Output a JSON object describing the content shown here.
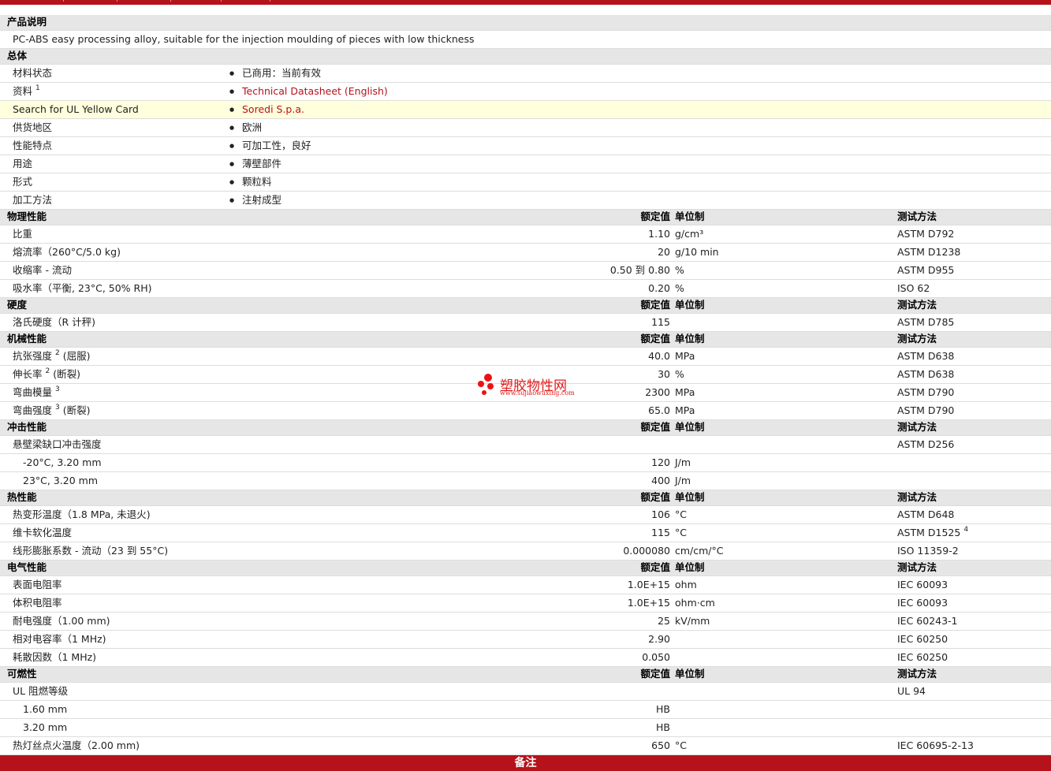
{
  "colors": {
    "brand_red": "#b5121b",
    "header_gray": "#e6e6e6",
    "highlight": "#ffffdd"
  },
  "desc": {
    "section": "产品说明",
    "text": "PC-ABS easy processing alloy, suitable for the injection moulding of pieces with low thickness"
  },
  "general": {
    "section": "总体",
    "rows": [
      {
        "label": "材料状态",
        "value": "已商用：当前有效"
      },
      {
        "label": "资料",
        "sup": "1",
        "value": "Technical Datasheet (English)"
      },
      {
        "label": "Search for UL Yellow Card",
        "value": "Soredi S.p.a."
      },
      {
        "label": "供货地区",
        "value": "欧洲"
      },
      {
        "label": "性能特点",
        "value": "可加工性，良好"
      },
      {
        "label": "用途",
        "value": "薄壁部件"
      },
      {
        "label": "形式",
        "value": "颗粒料"
      },
      {
        "label": "加工方法",
        "value": "注射成型"
      }
    ]
  },
  "col_headers": {
    "value": "额定值",
    "unit": "单位制",
    "test": "测试方法"
  },
  "physical": {
    "section": "物理性能",
    "rows": [
      {
        "label": "比重",
        "value": "1.10",
        "unit": "g/cm³",
        "test": "ASTM D792"
      },
      {
        "label": "熔流率（260°C/5.0 kg)",
        "value": "20",
        "unit": "g/10 min",
        "test": "ASTM D1238"
      },
      {
        "label": "收缩率 - 流动",
        "value": "0.50 到 0.80",
        "unit": "%",
        "test": "ASTM D955"
      },
      {
        "label": "吸水率（平衡, 23°C, 50% RH)",
        "value": "0.20",
        "unit": "%",
        "test": "ISO 62"
      }
    ]
  },
  "hardness": {
    "section": "硬度",
    "rows": [
      {
        "label": "洛氏硬度（R 计秤)",
        "value": "115",
        "unit": "",
        "test": "ASTM D785"
      }
    ]
  },
  "mechanical": {
    "section": "机械性能",
    "rows": [
      {
        "label": "抗张强度",
        "sup": "2",
        "suffix": "(屈服)",
        "value": "40.0",
        "unit": "MPa",
        "test": "ASTM D638"
      },
      {
        "label": "伸长率",
        "sup": "2",
        "suffix": "(断裂)",
        "value": "30",
        "unit": "%",
        "test": "ASTM D638"
      },
      {
        "label": "弯曲模量",
        "sup": "3",
        "suffix": "",
        "value": "2300",
        "unit": "MPa",
        "test": "ASTM D790"
      },
      {
        "label": "弯曲强度",
        "sup": "3",
        "suffix": "(断裂)",
        "value": "65.0",
        "unit": "MPa",
        "test": "ASTM D790"
      }
    ]
  },
  "impact": {
    "section": "冲击性能",
    "title_row": {
      "label": "悬壁梁缺口冲击强度",
      "test": "ASTM D256"
    },
    "rows": [
      {
        "label": "-20°C, 3.20 mm",
        "value": "120",
        "unit": "J/m"
      },
      {
        "label": "23°C, 3.20 mm",
        "value": "400",
        "unit": "J/m"
      }
    ]
  },
  "thermal": {
    "section": "热性能",
    "rows": [
      {
        "label": "热变形温度（1.8 MPa, 未退火)",
        "value": "106",
        "unit": "°C",
        "test": "ASTM D648"
      },
      {
        "label": "维卡软化温度",
        "value": "115",
        "unit": "°C",
        "test": "ASTM D1525",
        "test_sup": "4"
      },
      {
        "label": "线形膨胀系数 - 流动（23 到 55°C)",
        "value": "0.000080",
        "unit": "cm/cm/°C",
        "test": "ISO 11359-2"
      }
    ]
  },
  "electrical": {
    "section": "电气性能",
    "rows": [
      {
        "label": "表面电阻率",
        "value": "1.0E+15",
        "unit": "ohm",
        "test": "IEC 60093"
      },
      {
        "label": "体积电阻率",
        "value": "1.0E+15",
        "unit": "ohm·cm",
        "test": "IEC 60093"
      },
      {
        "label": "耐电强度（1.00 mm)",
        "value": "25",
        "unit": "kV/mm",
        "test": "IEC 60243-1"
      },
      {
        "label": "相对电容率（1 MHz)",
        "value": "2.90",
        "unit": "",
        "test": "IEC 60250"
      },
      {
        "label": "耗散因数（1 MHz)",
        "value": "0.050",
        "unit": "",
        "test": "IEC 60250"
      }
    ]
  },
  "flammability": {
    "section": "可燃性",
    "title_row": {
      "label": "UL 阻燃等级",
      "test": "UL 94"
    },
    "rows": [
      {
        "label": "1.60 mm",
        "value": "HB"
      },
      {
        "label": "3.20 mm",
        "value": "HB"
      }
    ],
    "last_row": {
      "label": "热灯丝点火温度（2.00 mm)",
      "value": "650",
      "unit": "°C",
      "test": "IEC 60695-2-13"
    }
  },
  "watermark": {
    "name": "塑胶物性网",
    "url": "www.sujiaowuxing.com"
  },
  "footer": {
    "label": "备注"
  }
}
